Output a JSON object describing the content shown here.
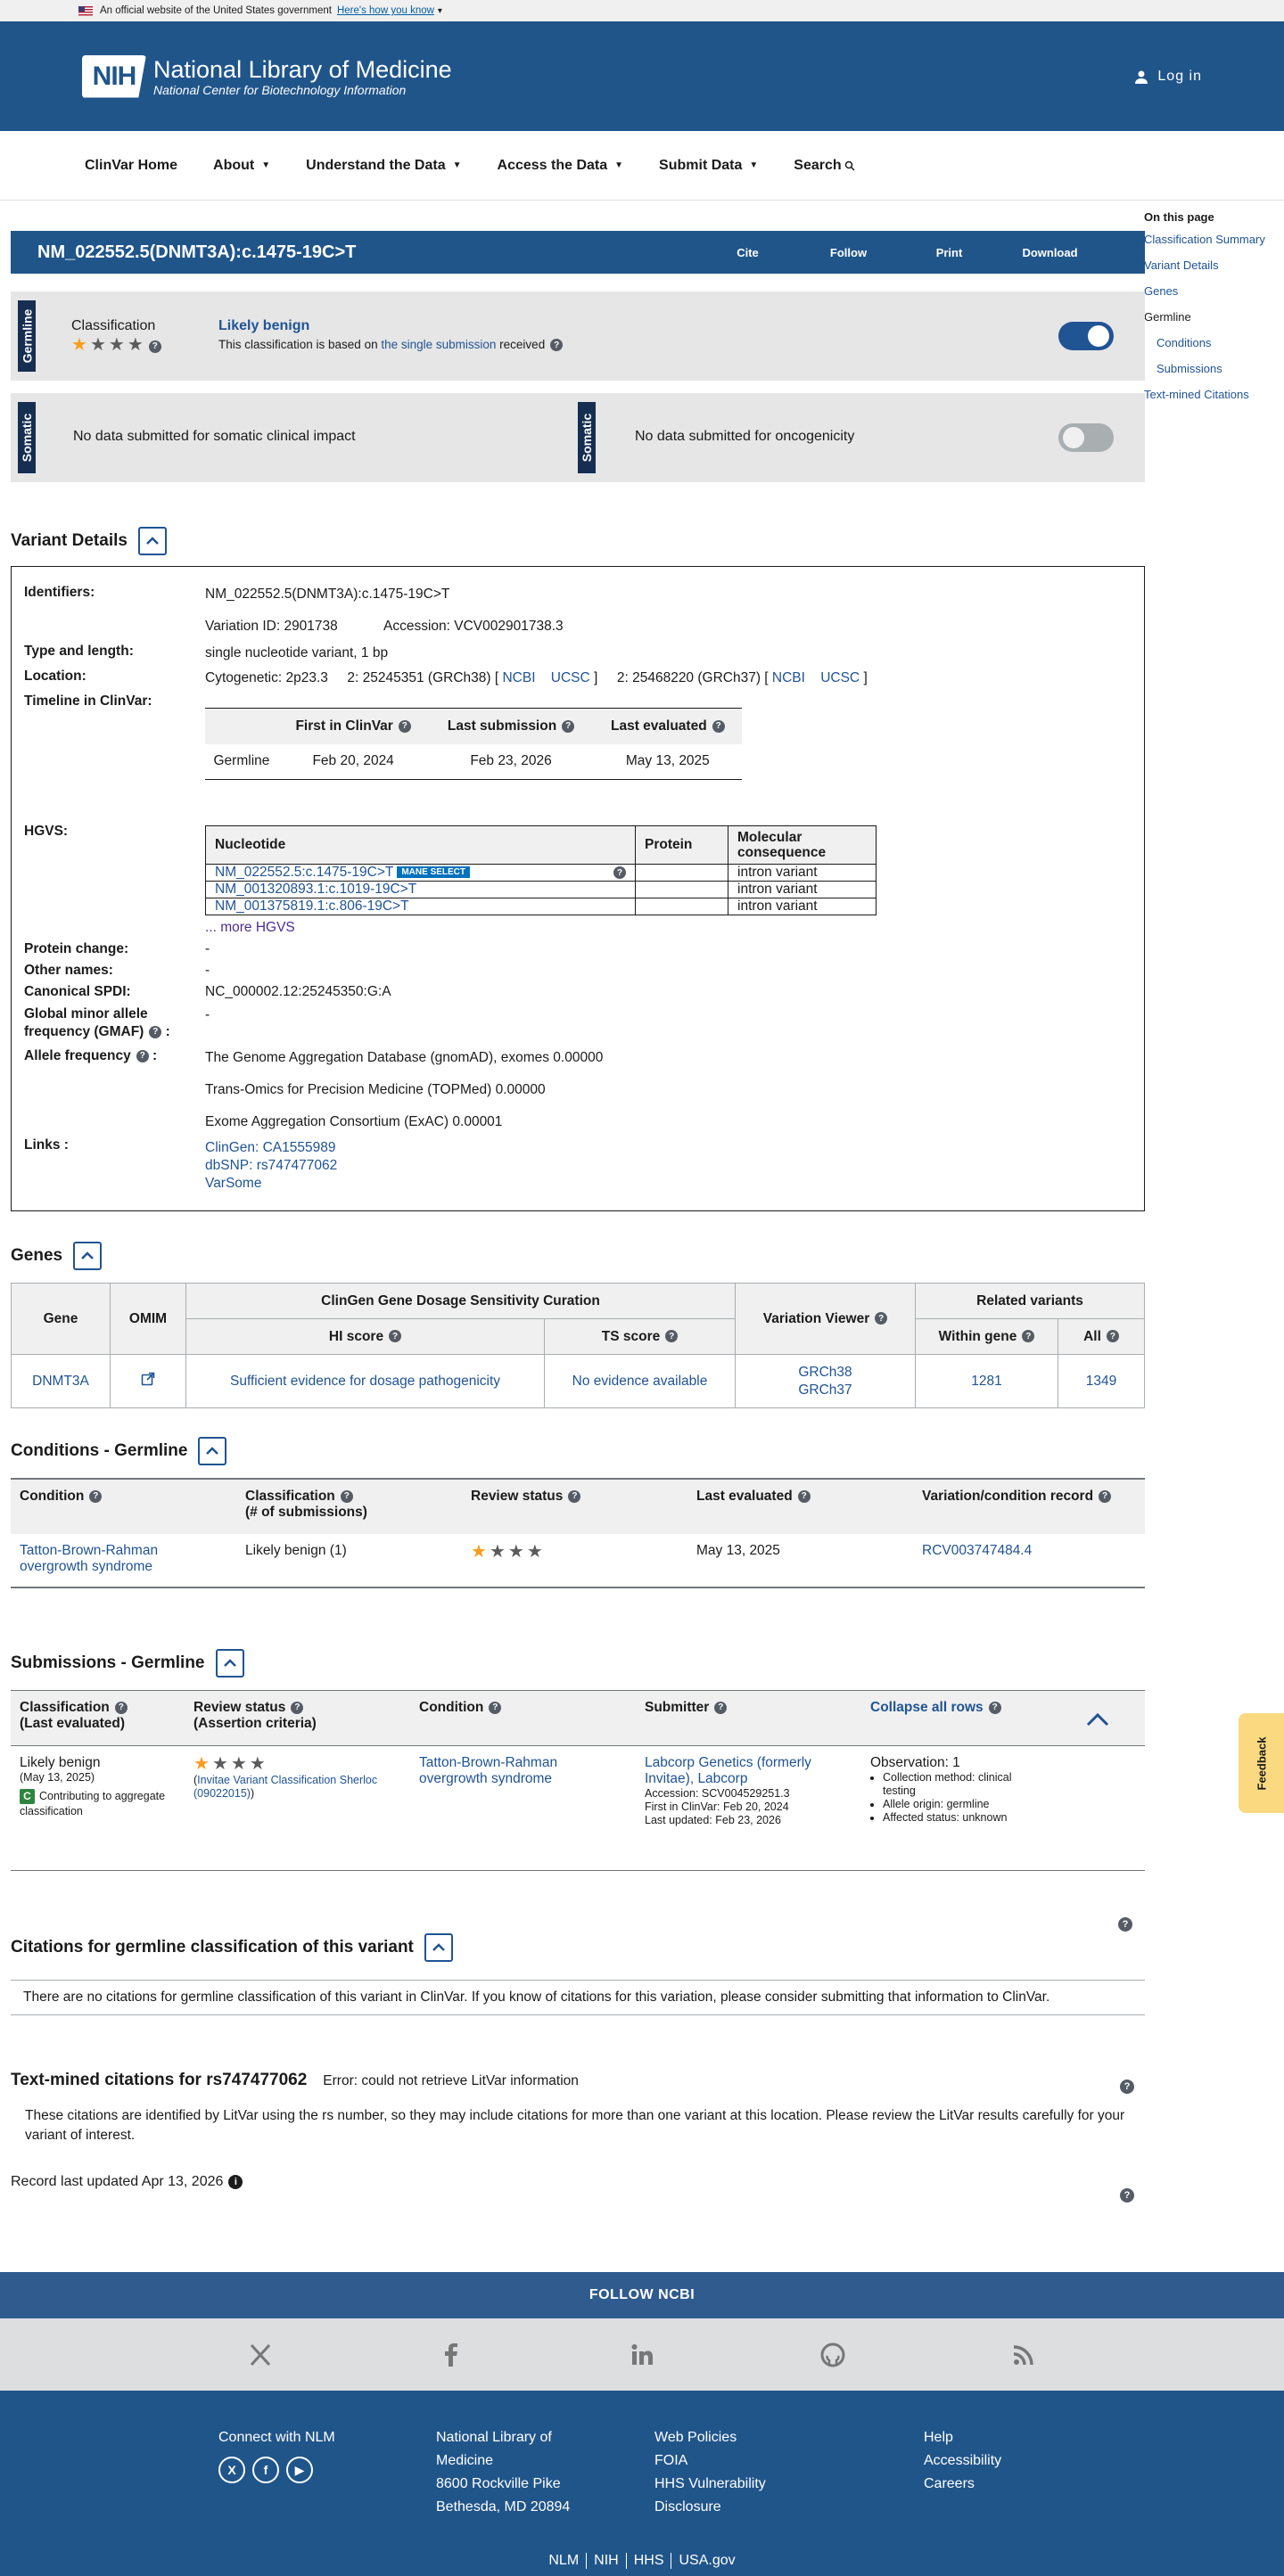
{
  "gov_banner": {
    "text": "An official website of the United States government",
    "link": "Here's how you know"
  },
  "header": {
    "logo": "NIH",
    "title": "National Library of Medicine",
    "subtitle": "National Center for Biotechnology Information",
    "login": "Log in"
  },
  "nav": {
    "items": [
      "ClinVar Home",
      "About",
      "Understand the Data",
      "Access the Data",
      "Submit Data",
      "Search"
    ]
  },
  "right_nav": {
    "title": "On this page",
    "items": [
      "Classification Summary",
      "Variant Details",
      "Genes",
      "Germline",
      "Conditions",
      "Submissions",
      "Text-mined Citations"
    ]
  },
  "title_bar": {
    "title": "NM_022552.5(DNMT3A):c.1475-19C>T",
    "actions": [
      "Cite",
      "Follow",
      "Print",
      "Download"
    ]
  },
  "germline": {
    "tab": "Germline",
    "classification_label": "Classification",
    "stars_filled": 1,
    "stars_total": 4,
    "result": "Likely benign",
    "basis_pre": "This classification is based on ",
    "basis_link": "the single submission",
    "basis_post": " received",
    "toggle_on": true
  },
  "somatic": {
    "tab": "Somatic",
    "clinical": "No data submitted for somatic clinical impact",
    "oncogenicity": "No data submitted for oncogenicity"
  },
  "variant_details": {
    "heading": "Variant Details",
    "labels": {
      "identifiers": "Identifiers:",
      "type": "Type and length:",
      "location": "Location:",
      "timeline": "Timeline in ClinVar:",
      "hgvs": "HGVS:",
      "protein_change": "Protein change:",
      "other_names": "Other names:",
      "spdi": "Canonical SPDI:",
      "gmaf_1": "Global minor allele",
      "gmaf_2": "frequency (GMAF)",
      "allele_freq": "Allele frequency",
      "links": "Links :"
    },
    "identifier": "NM_022552.5(DNMT3A):c.1475-19C>T",
    "variation_id": "Variation ID: 2901738",
    "accession": "Accession: VCV002901738.3",
    "type_length": "single nucleotide variant, 1 bp",
    "cytogenetic": "Cytogenetic: 2p23.3",
    "loc38": "2: 25245351 (GRCh38) [",
    "loc37": "2: 25468220 (GRCh37) [",
    "ncbi": "NCBI",
    "ucsc": "UCSC",
    "bracket_close": "]",
    "timeline": {
      "headers": [
        "",
        "First in ClinVar",
        "Last submission",
        "Last evaluated"
      ],
      "row": [
        "Germline",
        "Feb 20, 2024",
        "Feb 23, 2026",
        "May 13, 2025"
      ]
    },
    "hgvs": {
      "headers": [
        "Nucleotide",
        "Protein",
        "Molecular consequence"
      ],
      "mane": "MANE SELECT",
      "rows": [
        {
          "nuc": "NM_022552.5:c.1475-19C>T",
          "protein": "",
          "consequence": "intron variant"
        },
        {
          "nuc": "NM_001320893.1:c.1019-19C>T",
          "protein": "",
          "consequence": "intron variant"
        },
        {
          "nuc": "NM_001375819.1:c.806-19C>T",
          "protein": "",
          "consequence": "intron variant"
        }
      ],
      "more": "... more HGVS"
    },
    "protein_change": "-",
    "other_names": "-",
    "spdi": "NC_000002.12:25245350:G:A",
    "gmaf": "-",
    "allele_freqs": [
      "The Genome Aggregation Database (gnomAD), exomes 0.00000",
      "Trans-Omics for Precision Medicine (TOPMed) 0.00000",
      "Exome Aggregation Consortium (ExAC) 0.00001"
    ],
    "links": [
      "ClinGen: CA1555989",
      "dbSNP: rs747477062",
      "VarSome"
    ]
  },
  "genes": {
    "heading": "Genes",
    "headers": {
      "gene": "Gene",
      "omim": "OMIM",
      "clingen": "ClinGen Gene Dosage Sensitivity Curation",
      "hi": "HI score",
      "ts": "TS score",
      "viewer": "Variation Viewer",
      "related": "Related variants",
      "within": "Within gene",
      "all": "All"
    },
    "row": {
      "gene": "DNMT3A",
      "hi": "Sufficient evidence for dosage pathogenicity",
      "ts": "No evidence available",
      "viewer1": "GRCh38",
      "viewer2": "GRCh37",
      "within": "1281",
      "all": "1349"
    }
  },
  "conditions": {
    "heading": "Conditions - Germline",
    "headers": [
      "Condition",
      "Classification",
      "(# of submissions)",
      "Review status",
      "Last evaluated",
      "Variation/condition record"
    ],
    "row": {
      "condition": "Tatton-Brown-Rahman overgrowth syndrome",
      "classification": "Likely benign (1)",
      "stars_filled": 1,
      "last_evaluated": "May 13, 2025",
      "record": "RCV003747484.4"
    }
  },
  "submissions": {
    "heading": "Submissions - Germline",
    "headers": {
      "classification": "Classification",
      "classification_sub": "(Last evaluated)",
      "review": "Review status",
      "review_sub": "(Assertion criteria)",
      "condition": "Condition",
      "submitter": "Submitter",
      "collapse": "Collapse all rows"
    },
    "row": {
      "classification": "Likely benign",
      "date": "(May 13, 2025)",
      "badge": "C",
      "contributing": "Contributing to aggregate classification",
      "criteria_link": "Invitae Variant Classification Sherloc (09022015)",
      "paren_open": "(",
      "paren_close": ")",
      "condition": "Tatton-Brown-Rahman overgrowth syndrome",
      "submitter": "Labcorp Genetics (formerly Invitae), Labcorp",
      "accession": "Accession: SCV004529251.3",
      "first": "First in ClinVar: Feb 20, 2024",
      "updated": "Last updated: Feb 23, 2026",
      "observation": "Observation: 1",
      "obs_items": [
        "Collection method: clinical testing",
        "Allele origin: germline",
        "Affected status: unknown"
      ]
    }
  },
  "citations": {
    "heading": "Citations for germline classification of this variant",
    "text": "There are no citations for germline classification of this variant in ClinVar. If you know of citations for this variation, please consider submitting that information to ClinVar."
  },
  "text_mined": {
    "heading": "Text-mined citations for rs747477062",
    "error": "Error: could not retrieve LitVar information",
    "text": "These citations are identified by LitVar using the rs number, so they may include citations for more than one variant at this location. Please review the LitVar results carefully for your variant of interest."
  },
  "record_updated": "Record last updated Apr 13, 2026",
  "feedback": "Feedback",
  "footer": {
    "follow": "FOLLOW NCBI",
    "connect": "Connect with NLM",
    "address": [
      "National Library of",
      "Medicine",
      "8600 Rockville Pike",
      "Bethesda, MD 20894"
    ],
    "policies": [
      "Web Policies",
      "FOIA",
      "HHS Vulnerability",
      "Disclosure"
    ],
    "help": [
      "Help",
      "Accessibility",
      "Careers"
    ],
    "bottom": [
      "NLM",
      "NIH",
      "HHS",
      "USA.gov"
    ]
  },
  "colors": {
    "primary": "#20558a",
    "link": "#205493",
    "star": "#fa9c1e",
    "feedback": "#fad980"
  }
}
